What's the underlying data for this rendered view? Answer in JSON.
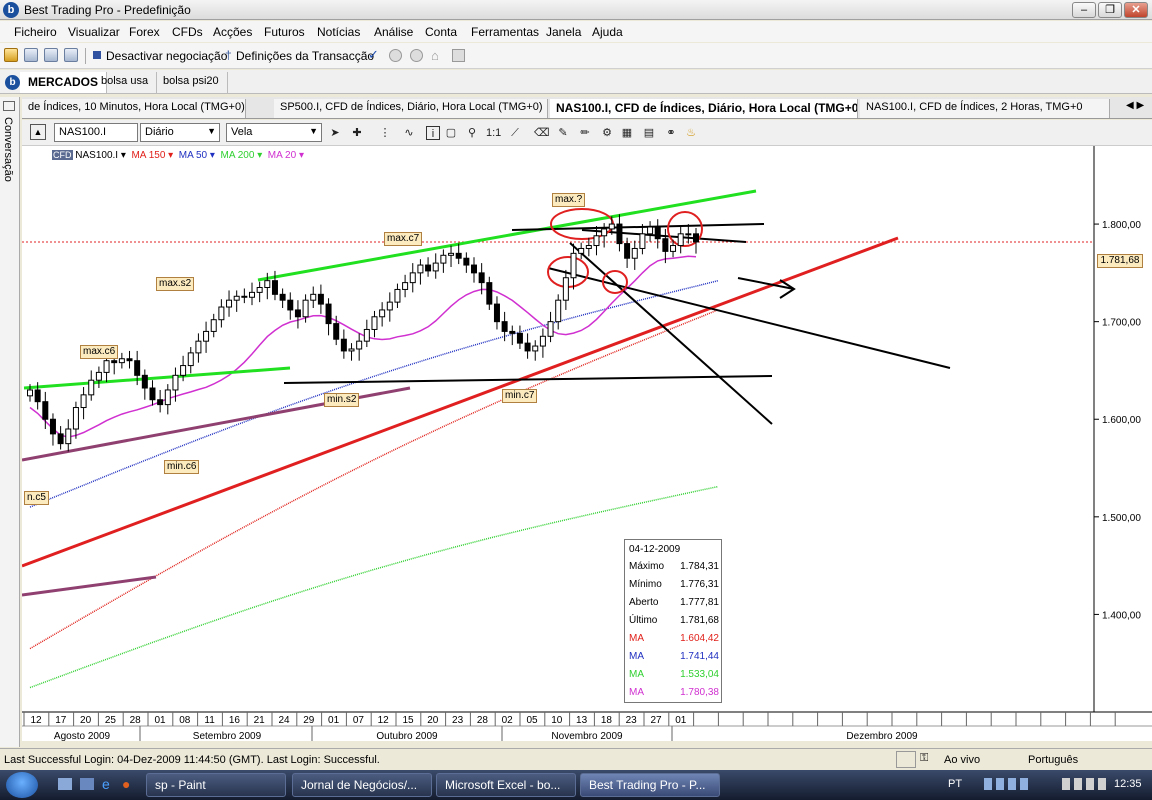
{
  "window": {
    "title": "Best Trading Pro - Predefinição"
  },
  "menu": [
    "Ficheiro",
    "Visualizar",
    "Forex",
    "CFDs",
    "Acções",
    "Futuros",
    "Notícias",
    "Análise",
    "Conta",
    "Ferramentas",
    "Janela",
    "Ajuda"
  ],
  "toolbar": {
    "deactivate_label": "Desactivar negociação",
    "transaction_settings_label": "Definições da Transacção"
  },
  "workspace_tabs": [
    "MERCADOS",
    "bolsa usa",
    "bolsa psi20"
  ],
  "side_panel": {
    "label": "Conversação"
  },
  "chart_tabs": [
    "de Índices, 10 Minutos, Hora Local (TMG+0)",
    "SP500.I, CFD de Índices, Diário, Hora Local (TMG+0)",
    "NAS100.I, CFD de Índices, Diário, Hora Local (TMG+0)",
    "NAS100.I, CFD de Índices, 2 Horas, TMG+0"
  ],
  "chart_toolbar": {
    "symbol": "NAS100.I",
    "period": "Diário",
    "chart_style": "Vela"
  },
  "legend": [
    {
      "label": "NAS100.I",
      "color": "#000000"
    },
    {
      "label": "MA 150",
      "color": "#e0201a"
    },
    {
      "label": "MA 50",
      "color": "#2030c0"
    },
    {
      "label": "MA 200",
      "color": "#30d030"
    },
    {
      "label": "MA 20",
      "color": "#d030d0"
    }
  ],
  "chart_data": {
    "type": "candlestick",
    "ylim": [
      1300,
      1880
    ],
    "y_ticks": [
      "1.400,00",
      "1.500,00",
      "1.600,00",
      "1.700,00",
      "1.800,00"
    ],
    "last_price": 1781.68,
    "last_price_label": "1.781,68",
    "x_day_ticks": [
      "12",
      "17",
      "20",
      "25",
      "28",
      "01",
      "08",
      "11",
      "16",
      "21",
      "24",
      "29",
      "01",
      "07",
      "12",
      "15",
      "20",
      "23",
      "28",
      "02",
      "05",
      "10",
      "13",
      "18",
      "23",
      "27",
      "01"
    ],
    "x_month_labels": [
      "Agosto 2009",
      "Setembro 2009",
      "Outubro 2009",
      "Novembro 2009",
      "Dezembro 2009"
    ],
    "closes": [
      1630,
      1618,
      1600,
      1585,
      1575,
      1590,
      1612,
      1625,
      1640,
      1648,
      1660,
      1658,
      1662,
      1660,
      1645,
      1632,
      1620,
      1615,
      1630,
      1645,
      1655,
      1668,
      1680,
      1690,
      1702,
      1715,
      1722,
      1726,
      1725,
      1730,
      1735,
      1742,
      1728,
      1722,
      1712,
      1705,
      1722,
      1728,
      1718,
      1698,
      1682,
      1670,
      1672,
      1680,
      1692,
      1705,
      1712,
      1720,
      1733,
      1740,
      1750,
      1758,
      1752,
      1760,
      1768,
      1770,
      1765,
      1758,
      1750,
      1740,
      1718,
      1700,
      1690,
      1688,
      1678,
      1670,
      1675,
      1685,
      1700,
      1722,
      1745,
      1770,
      1775,
      1778,
      1788,
      1795,
      1800,
      1780,
      1765,
      1775,
      1790,
      1797,
      1785,
      1772,
      1778,
      1790,
      1790,
      1781.68
    ],
    "ma150": [
      1365,
      1712
    ],
    "ma50": [
      1510,
      1742
    ],
    "ma200": [
      1325,
      1531
    ],
    "ma20": [
      1600,
      1780
    ],
    "annotations": [
      "max.?",
      "max.c7",
      "max.s2",
      "max.c6",
      "min.s2",
      "min.c7",
      "min.c6",
      "n.c5"
    ]
  },
  "info_box": {
    "date": "04-12-2009",
    "rows": [
      {
        "label": "Máximo",
        "value": "1.784,31",
        "color": "#000000"
      },
      {
        "label": "Mínimo",
        "value": "1.776,31",
        "color": "#000000"
      },
      {
        "label": "Aberto",
        "value": "1.777,81",
        "color": "#000000"
      },
      {
        "label": "Último",
        "value": "1.781,68",
        "color": "#000000"
      },
      {
        "label": "MA",
        "value": "1.604,42",
        "color": "#e0201a"
      },
      {
        "label": "MA",
        "value": "1.741,44",
        "color": "#2030c0"
      },
      {
        "label": "MA",
        "value": "1.533,04",
        "color": "#30d030"
      },
      {
        "label": "MA",
        "value": "1.780,38",
        "color": "#d030d0"
      }
    ]
  },
  "status": {
    "login": "Last Successful Login: 04-Dez-2009 11:44:50 (GMT). Last Login: Successful.",
    "mode": "Ao vivo",
    "language": "Português"
  },
  "taskbar": {
    "tasks": [
      "sp - Paint",
      "Jornal de Negócios/...",
      "Microsoft Excel - bo...",
      "Best Trading Pro - P..."
    ],
    "lang": "PT",
    "time": "12:35"
  }
}
